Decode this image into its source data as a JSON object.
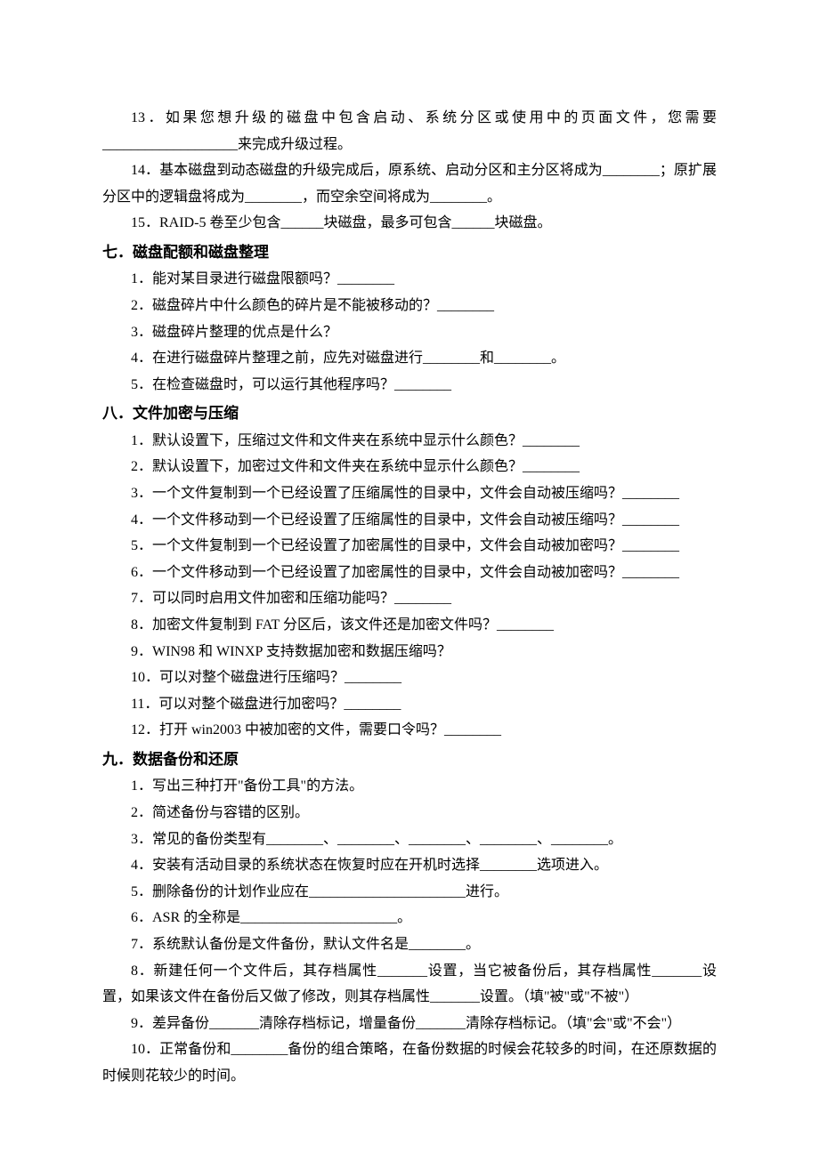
{
  "s6_tail": [
    "13．如果您想升级的磁盘中包含启动、系统分区或使用中的页面文件，您需要___________________来完成升级过程。",
    "14．基本磁盘到动态磁盘的升级完成后，原系统、启动分区和主分区将成为________；原扩展分区中的逻辑盘将成为________，而空余空间将成为________。",
    "15．RAID-5 卷至少包含______块磁盘，最多可包含______块磁盘。"
  ],
  "s7": {
    "heading": "七．磁盘配额和磁盘整理",
    "items": [
      "1．能对某目录进行磁盘限额吗？________",
      "2．磁盘碎片中什么颜色的碎片是不能被移动的？________",
      "3．磁盘碎片整理的优点是什么？",
      "4．在进行磁盘碎片整理之前，应先对磁盘进行________和________。",
      "5．在检查磁盘时，可以运行其他程序吗？________"
    ]
  },
  "s8": {
    "heading": "八．文件加密与压缩",
    "items": [
      "1．默认设置下，压缩过文件和文件夹在系统中显示什么颜色？________",
      "2．默认设置下，加密过文件和文件夹在系统中显示什么颜色？________",
      "3．一个文件复制到一个已经设置了压缩属性的目录中，文件会自动被压缩吗？________",
      "4．一个文件移动到一个已经设置了压缩属性的目录中，文件会自动被压缩吗？________",
      "5．一个文件复制到一个已经设置了加密属性的目录中，文件会自动被加密吗？________",
      "6．一个文件移动到一个已经设置了加密属性的目录中，文件会自动被加密吗？________",
      "7．可以同时启用文件加密和压缩功能吗？________",
      "8．加密文件复制到 FAT 分区后，该文件还是加密文件吗？________",
      "9．WIN98 和 WINXP 支持数据加密和数据压缩吗？",
      "10．可以对整个磁盘进行压缩吗？________",
      "11．可以对整个磁盘进行加密吗？________",
      "12．打开 win2003 中被加密的文件，需要口令吗？________"
    ]
  },
  "s9": {
    "heading": "九．数据备份和还原",
    "items": [
      "1．写出三种打开\"备份工具\"的方法。",
      "2．简述备份与容错的区别。",
      "3．常见的备份类型有________、________、________、________、________。",
      "4．安装有活动目录的系统状态在恢复时应在开机时选择________选项进入。",
      "5．删除备份的计划作业应在______________________进行。",
      "6．ASR 的全称是______________________。",
      "7．系统默认备份是文件备份，默认文件名是________。",
      "8．新建任何一个文件后，其存档属性_______设置，当它被备份后，其存档属性_______设置，如果该文件在备份后又做了修改，则其存档属性_______设置。（填\"被\"或\"不被\"）",
      "9．差异备份_______清除存档标记，增量备份_______清除存档标记。（填\"会\"或\"不会\"）",
      "10．正常备份和________备份的组合策略，在备份数据的时候会花较多的时间，在还原数据的时候则花较少的时间。"
    ]
  }
}
